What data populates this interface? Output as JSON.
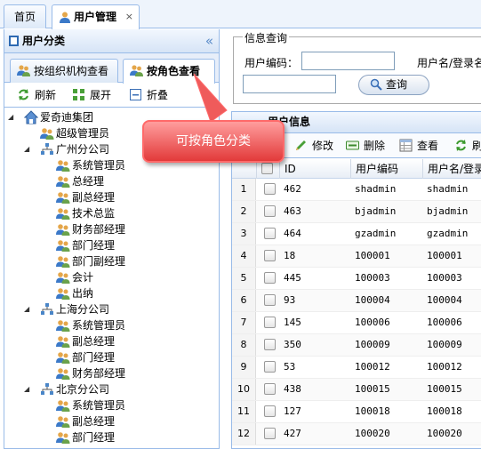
{
  "tabs": {
    "home": "首页",
    "user_mgmt": "用户管理",
    "close": "×"
  },
  "left_panel": {
    "title": "用户分类",
    "collapse": "«",
    "subtabs": {
      "by_org": "按组织机构查看",
      "by_role": "按角色查看"
    },
    "toolbar": {
      "refresh": "刷新",
      "expand": "展开",
      "fold": "折叠"
    },
    "tree": {
      "root": "爱奇迪集团",
      "nodes": [
        "超级管理员",
        "广州分公司",
        "系统管理员",
        "总经理",
        "副总经理",
        "技术总监",
        "财务部经理",
        "部门经理",
        "部门副经理",
        "会计",
        "出纳",
        "上海分公司",
        "系统管理员",
        "副总经理",
        "部门经理",
        "财务部经理",
        "北京分公司",
        "系统管理员",
        "副总经理",
        "部门经理"
      ]
    }
  },
  "query": {
    "legend": "信息查询",
    "user_code_label": "用户编码：",
    "user_code_value": "",
    "username_label": "用户名/登录名",
    "username_value": "",
    "query_button": "查询"
  },
  "grid": {
    "title": "用户信息",
    "toolbar": {
      "edit": "修改",
      "delete": "删除",
      "view": "查看",
      "refresh": "刷"
    },
    "columns": [
      "ID",
      "用户编码",
      "用户名/登录"
    ],
    "rows": [
      {
        "n": "1",
        "id": "462",
        "code": "shadmin",
        "name": "shadmin"
      },
      {
        "n": "2",
        "id": "463",
        "code": "bjadmin",
        "name": "bjadmin"
      },
      {
        "n": "3",
        "id": "464",
        "code": "gzadmin",
        "name": "gzadmin"
      },
      {
        "n": "4",
        "id": "18",
        "code": "100001",
        "name": "100001"
      },
      {
        "n": "5",
        "id": "445",
        "code": "100003",
        "name": "100003"
      },
      {
        "n": "6",
        "id": "93",
        "code": "100004",
        "name": "100004"
      },
      {
        "n": "7",
        "id": "145",
        "code": "100006",
        "name": "100006"
      },
      {
        "n": "8",
        "id": "350",
        "code": "100009",
        "name": "100009"
      },
      {
        "n": "9",
        "id": "53",
        "code": "100012",
        "name": "100012"
      },
      {
        "n": "10",
        "id": "438",
        "code": "100015",
        "name": "100015"
      },
      {
        "n": "11",
        "id": "127",
        "code": "100018",
        "name": "100018"
      },
      {
        "n": "12",
        "id": "427",
        "code": "100020",
        "name": "100020"
      }
    ]
  },
  "callout": "可按角色分类"
}
